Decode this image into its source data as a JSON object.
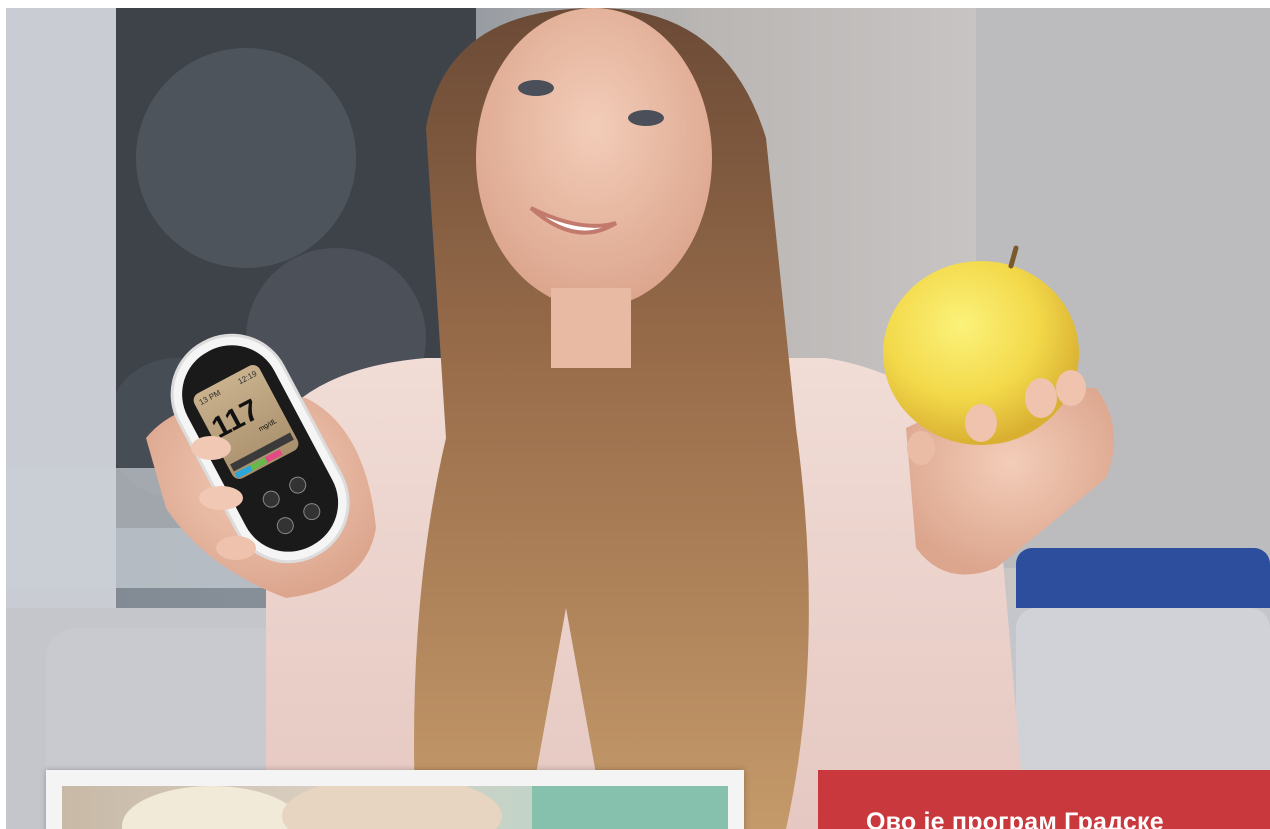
{
  "hero": {
    "meter": {
      "reading": "117",
      "unit": "mg/dL",
      "time": "13 PM",
      "time2": "12:19"
    }
  },
  "program_card": {
    "text": "Ово је програм Градске"
  },
  "colors": {
    "card_red": "#c8383d",
    "card_border": "#f4f4f4"
  }
}
